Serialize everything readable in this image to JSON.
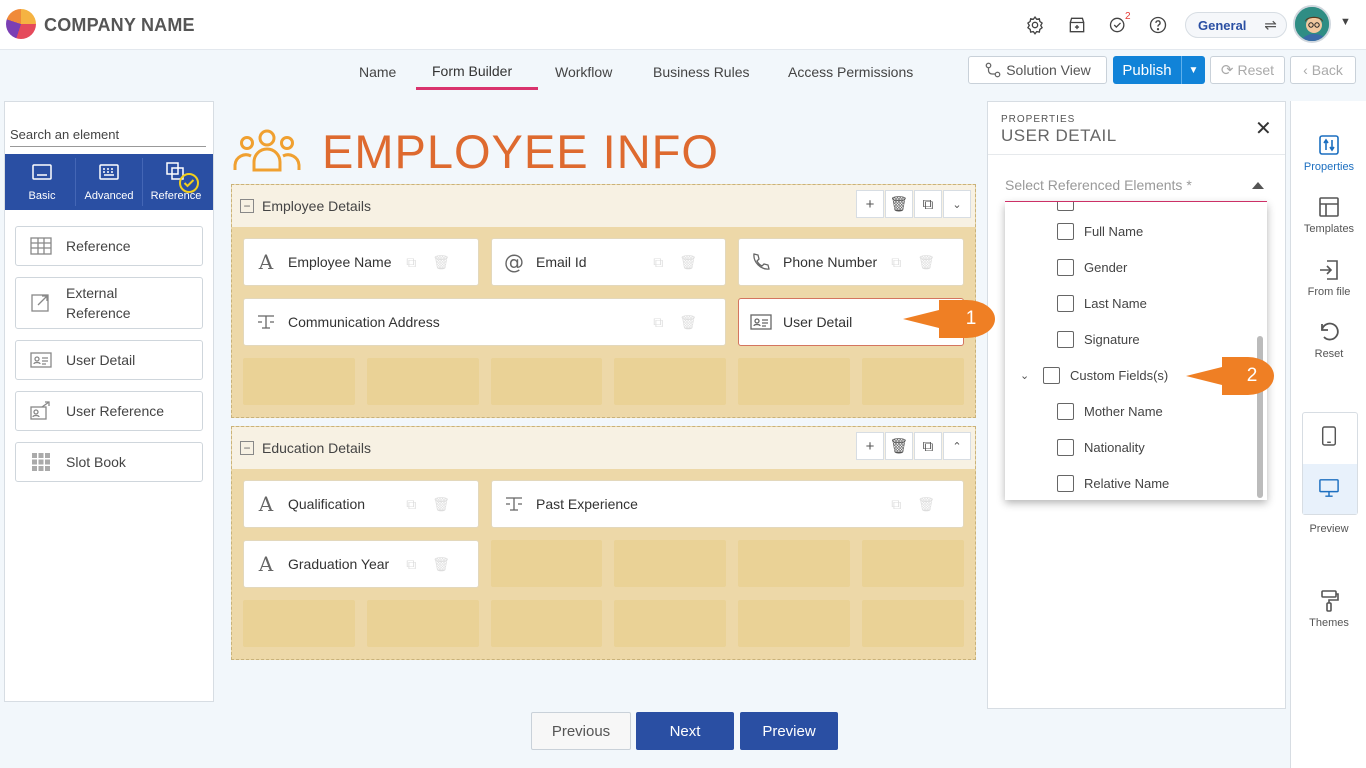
{
  "header": {
    "company_name": "COMPANY NAME",
    "notification_count": "2",
    "workspace": "General"
  },
  "tabs": [
    "Name",
    "Form Builder",
    "Workflow",
    "Business Rules",
    "Access Permissions"
  ],
  "active_tab": "Form Builder",
  "toolbar": {
    "solution_view": "Solution View",
    "publish": "Publish",
    "reset": "Reset",
    "back": "Back"
  },
  "left_panel": {
    "search_placeholder": "Search an element",
    "categories": [
      "Basic",
      "Advanced",
      "Reference"
    ],
    "active_category": "Reference",
    "elements": [
      "Reference",
      "External Reference",
      "User Detail",
      "User Reference",
      "Slot Book"
    ]
  },
  "form": {
    "title": "EMPLOYEE INFO",
    "sections": [
      {
        "name": "Employee Details",
        "fields": [
          "Employee Name",
          "Email Id",
          "Phone Number",
          "Communication Address",
          "User Detail"
        ]
      },
      {
        "name": "Education Details",
        "fields": [
          "Qualification",
          "Past Experience",
          "Graduation Year"
        ]
      }
    ]
  },
  "properties": {
    "small_label": "PROPERTIES",
    "title": "USER DETAIL",
    "select_placeholder": "Select Referenced Elements *",
    "options": [
      "Full Name",
      "Gender",
      "Last Name",
      "Signature",
      "Custom Fields(s)",
      "Mother Name",
      "Nationality",
      "Relative Name"
    ]
  },
  "callouts": [
    "1",
    "2"
  ],
  "rail": {
    "items": [
      "Properties",
      "Templates",
      "From file",
      "Reset"
    ],
    "preview_label": "Preview",
    "themes_label": "Themes"
  },
  "footer": {
    "previous": "Previous",
    "next": "Next",
    "preview": "Preview"
  },
  "colors": {
    "accent_blue": "#2a4fa3",
    "publish_blue": "#1183d8",
    "title_orange": "#de6a2f",
    "callout_orange": "#ef7f24",
    "tab_underline": "#d9336d"
  }
}
